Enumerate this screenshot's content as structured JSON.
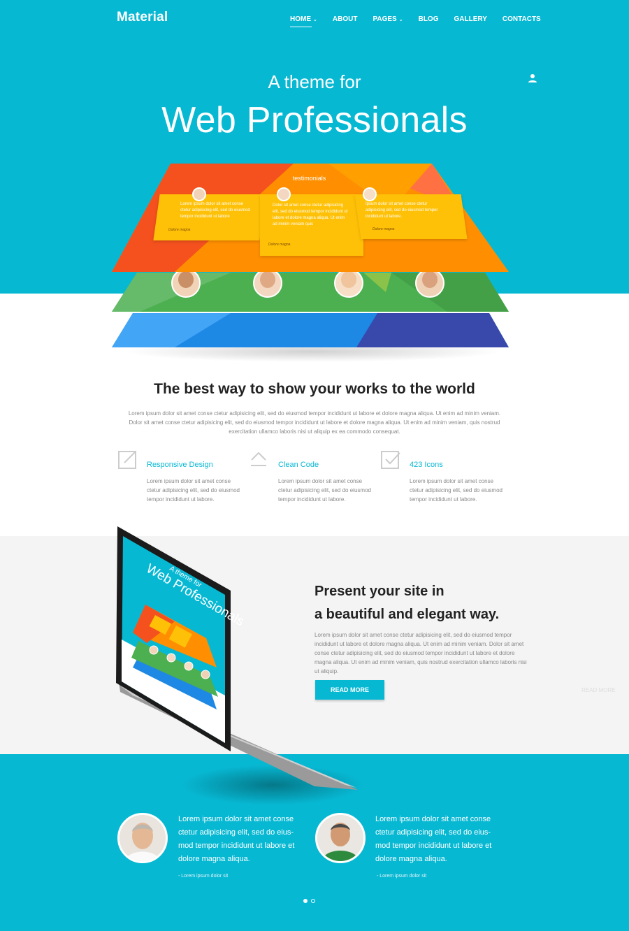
{
  "header": {
    "logo": "Material",
    "nav": [
      {
        "label": "HOME",
        "caret": true,
        "active": true
      },
      {
        "label": "ABOUT",
        "caret": false
      },
      {
        "label": "PAGES",
        "caret": true
      },
      {
        "label": "BLOG",
        "caret": false
      },
      {
        "label": "GALLERY",
        "caret": false
      },
      {
        "label": "CONTACTS",
        "caret": false
      }
    ],
    "caret_glyph": "⌄"
  },
  "hero": {
    "subtitle": "A theme for",
    "title": "Web Professionals",
    "card_heading": "testimonials",
    "cards": [
      {
        "text": "Lorem ipsum dolor sit amet conse ctetur adipisicing elit, sed do eiusmod tempor incididunt ut labore",
        "author": "Dolore magna"
      },
      {
        "text": "Dolor sit amet conse ctetur adipisicing elit, sed do eiusmod tempor incididunt ut labore et dolore magna aliqua. Ut enim ad minim veniam quis",
        "author": "Dolore magna"
      },
      {
        "text": "Ipsum dolor sit amet conse ctetur adipisicing elit, sed do eiusmod tempor incididunt ut labore.",
        "author": "Dolore magna"
      }
    ]
  },
  "about": {
    "title": "The best way to show your works to the world",
    "text": "Lorem ipsum dolor sit amet conse ctetur adipisicing elit, sed do eiusmod tempor incididunt ut labore et dolore magna aliqua. Ut enim ad minim veniam. Dolor sit amet conse ctetur adipisicing elit, sed do eiusmod tempor incididunt ut labore et dolore magna aliqua. Ut enim ad minim veniam, quis nostrud exercitation ullamco laboris nisi ut aliquip ex ea commodo consequat.",
    "features": [
      {
        "icon": "external-link-icon",
        "title": "Responsive Design",
        "text": "Lorem ipsum dolor sit amet conse ctetur adipisicing elit, sed do eiusmod tempor incididunt ut labore."
      },
      {
        "icon": "chevron-up-icon",
        "title": "Clean Code",
        "text": "Lorem ipsum dolor sit amet conse ctetur adipisicing elit, sed do eiusmod tempor incididunt ut labore."
      },
      {
        "icon": "check-square-icon",
        "title": "423 Icons",
        "text": "Lorem ipsum dolor sit amet conse ctetur adipisicing elit, sed do eiusmod tempor incididunt ut labore."
      }
    ]
  },
  "present": {
    "title_line1": "Present your site in",
    "title_line2": "a beautiful and elegant way.",
    "text": "Lorem ipsum dolor sit amet conse ctetur adipisicing elit, sed do eiusmod tempor incididunt ut labore et dolore magna aliqua. Ut enim ad minim veniam. Dolor sit amet conse ctetur adipisicing elit, sed do eiusmod tempor incididunt ut labore et dolore magna aliqua. Ut enim ad minim veniam, quis nostrud exercitation ullamco laboris nisi ut aliquip.",
    "button": "READ MORE",
    "ghost_button": "READ MORE",
    "screen_subtitle": "A theme for",
    "screen_title": "Web Professionals"
  },
  "testimonials": [
    {
      "quote": "Lorem ipsum dolor sit amet conse ctetur adipisicing elit, sed do eius- mod tempor incididunt ut labore et dolore magna aliqua.",
      "author": "- Lorem ipsum dolor sit"
    },
    {
      "quote": "Lorem ipsum dolor sit amet conse ctetur adipisicing elit, sed do eius- mod tempor incididunt ut labore et dolore magna aliqua.",
      "author": "- Lorem ipsum dolor sit"
    }
  ],
  "slider": {
    "active": 1,
    "count": 2
  },
  "colors": {
    "accent": "#07b8d3",
    "orange": "#ff8f00",
    "green": "#4caf50",
    "blue": "#1e88e5"
  }
}
